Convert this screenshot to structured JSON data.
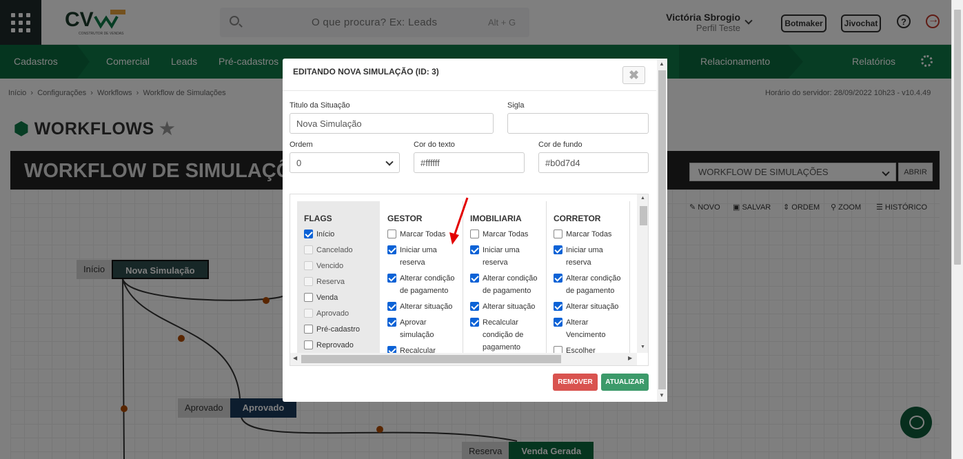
{
  "topbar": {
    "search_placeholder": "O que procura? Ex: Leads",
    "search_shortcut": "Alt + G",
    "user_name": "Victória Sbrogio",
    "user_profile": "Perfil Teste",
    "btn_botmaker": "Botmaker",
    "btn_jivochat": "Jivochat",
    "help": "?",
    "logo_text": "CV",
    "logo_sub": "CONSTRUTOR DE VENDAS"
  },
  "nav": {
    "items": [
      "Cadastros",
      "Comercial",
      "Leads",
      "Pré-cadastros",
      "Relacionamento",
      "Relatórios"
    ]
  },
  "breadcrumb": {
    "home": "Início",
    "items": [
      "Configurações",
      "Workflows",
      "Workflow de Simulações"
    ],
    "server_time": "Horário do servidor: 28/09/2022 10h23 - v10.4.49"
  },
  "page": {
    "title": "WORKFLOWS",
    "wf_title": "WORKFLOW DE SIMULAÇÕ",
    "wf_select": "WORKFLOW DE SIMULAÇÕES",
    "abrir": "ABRIR"
  },
  "toolbar": [
    "NOVO",
    "SALVAR",
    "ORDEM",
    "ZOOM",
    "HISTÓRICO"
  ],
  "nodes": [
    {
      "left": "Início",
      "right": "Nova Simulação",
      "color": "#2f4f4f"
    },
    {
      "left": "Aprovado",
      "right": "Aprovado",
      "color": "#1a3a5c"
    },
    {
      "left": "Reserva",
      "right": "Venda Gerada",
      "color": "#0a6b3f"
    }
  ],
  "modal": {
    "title": "EDITANDO NOVA SIMULAÇÃO (ID: 3)",
    "close": "✖",
    "label_titulo": "Titulo da Situação",
    "titulo": "Nova Simulação",
    "label_sigla": "Sigla",
    "sigla": "",
    "label_ordem": "Ordem",
    "ordem": "0",
    "label_cor_texto": "Cor do texto",
    "cor_texto": "#ffffff",
    "label_cor_fundo": "Cor de fundo",
    "cor_fundo": "#b0d7d4",
    "btn_remover": "REMOVER",
    "btn_atualizar": "ATUALIZAR"
  },
  "columns": [
    {
      "title": "FLAGS",
      "items": [
        {
          "label": "Início",
          "checked": true
        },
        {
          "label": "Cancelado",
          "disabled": true
        },
        {
          "label": "Vencido",
          "disabled": true
        },
        {
          "label": "Reserva",
          "disabled": true
        },
        {
          "label": "Venda",
          "checked": false
        },
        {
          "label": "Aprovado",
          "disabled": true
        },
        {
          "label": "Pré-cadastro",
          "checked": false
        },
        {
          "label": "Reprovado",
          "checked": false
        }
      ]
    },
    {
      "title": "GESTOR",
      "items": [
        {
          "label": "Marcar Todas",
          "checked": false
        },
        {
          "label": "Iniciar uma reserva",
          "checked": true
        },
        {
          "label": "Alterar condição de pagamento",
          "checked": true
        },
        {
          "label": "Alterar situação",
          "checked": true
        },
        {
          "label": "Aprovar simulação",
          "checked": true
        },
        {
          "label": "Recalcular",
          "checked": true
        }
      ]
    },
    {
      "title": "IMOBILIARIA",
      "items": [
        {
          "label": "Marcar Todas",
          "checked": false
        },
        {
          "label": "Iniciar uma reserva",
          "checked": true
        },
        {
          "label": "Alterar condição de pagamento",
          "checked": true
        },
        {
          "label": "Alterar situação",
          "checked": true
        },
        {
          "label": "Recalcular condição de pagamento",
          "checked": true
        }
      ]
    },
    {
      "title": "CORRETOR",
      "items": [
        {
          "label": "Marcar Todas",
          "checked": false
        },
        {
          "label": "Iniciar uma reserva",
          "checked": true
        },
        {
          "label": "Alterar condição de pagamento",
          "checked": true
        },
        {
          "label": "Alterar situação",
          "checked": true
        },
        {
          "label": "Alterar Vencimento",
          "checked": true
        },
        {
          "label": "Escolher",
          "checked": false
        }
      ]
    }
  ]
}
